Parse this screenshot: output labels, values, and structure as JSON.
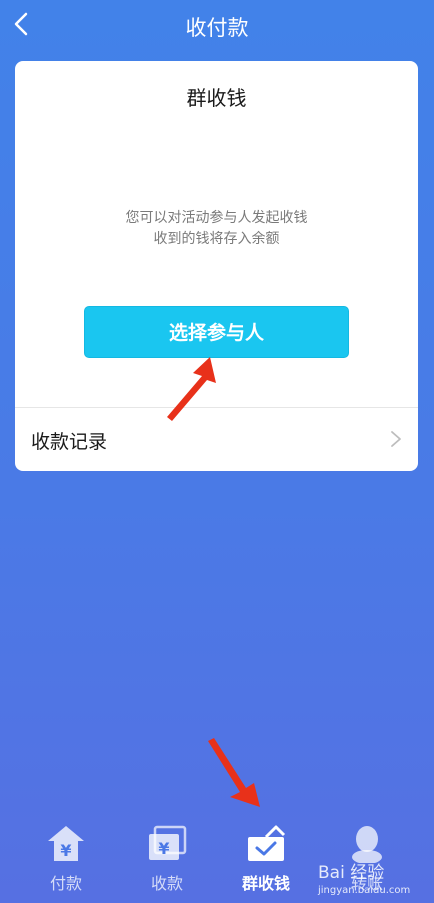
{
  "header": {
    "title": "收付款",
    "back_icon": "chevron-left-icon"
  },
  "card": {
    "title": "群收钱",
    "description_line1": "您可以对活动参与人发起收钱",
    "description_line2": "收到的钱将存入余额",
    "select_button": "选择参与人",
    "record_label": "收款记录"
  },
  "tabs": [
    {
      "label": "付款",
      "icon": "payment-icon",
      "active": false
    },
    {
      "label": "收款",
      "icon": "receive-icon",
      "active": false
    },
    {
      "label": "群收钱",
      "icon": "group-collect-icon",
      "active": true
    },
    {
      "label": "转账",
      "icon": "transfer-icon",
      "active": false
    }
  ],
  "watermark": {
    "main": "Bai 经验",
    "sub": "jingyan.baidu.com"
  },
  "colors": {
    "accent": "#1ac6f0",
    "annotation_arrow": "#e8311a",
    "background_top": "#4282e9",
    "background_bottom": "#5670e2"
  }
}
